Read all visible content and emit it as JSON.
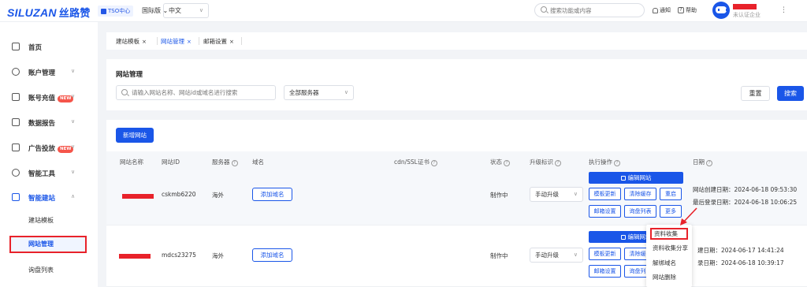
{
  "header": {
    "logo_en": "SILUZAN",
    "logo_cn": "丝路赞",
    "tso_label": "TSO中心",
    "region_label": "国际版",
    "language": "中文",
    "search_placeholder": "搜索功能或内容",
    "notify_label": "通知",
    "help_label": "帮助",
    "user_status": "未认证企业"
  },
  "sidebar": {
    "items": [
      {
        "label": "首页",
        "icon": "home-icon"
      },
      {
        "label": "账户管理",
        "icon": "user-icon"
      },
      {
        "label": "账号充值",
        "icon": "wallet-icon",
        "badge": "NEW"
      },
      {
        "label": "数据报告",
        "icon": "chart-icon"
      },
      {
        "label": "广告投放",
        "icon": "ad-icon",
        "badge": "NEW"
      },
      {
        "label": "智能工具",
        "icon": "layers-icon"
      },
      {
        "label": "智能建站",
        "icon": "site-icon"
      }
    ],
    "subitems": [
      {
        "label": "建站模板"
      },
      {
        "label": "网站管理"
      },
      {
        "label": "询盘列表"
      }
    ]
  },
  "tabs": [
    {
      "label": "建站模板"
    },
    {
      "label": "网站管理"
    },
    {
      "label": "邮箱设置"
    }
  ],
  "search_panel": {
    "title": "网站管理",
    "keyword_placeholder": "请输入网站名称、网站id或域名进行搜索",
    "server_value": "全部服务器",
    "reset_label": "重置",
    "search_label": "搜索"
  },
  "list": {
    "new_site_label": "新增网站",
    "columns": [
      "网站名称",
      "网站ID",
      "服务器",
      "域名",
      "cdn/SSL证书",
      "状态",
      "升级标识",
      "执行操作",
      "日期"
    ],
    "rows": [
      {
        "site_id": "cskmb6220",
        "server": "海外",
        "add_domain": "添加域名",
        "status": "制作中",
        "upgrade": "手动升级",
        "edit_label": "编辑网站",
        "ops": [
          "模板更新",
          "清除缓存",
          "重启",
          "邮箱设置",
          "询盘列表",
          "更多"
        ],
        "created": "网站创建日期：2024-06-18 09:53:30",
        "last_login": "最后登录日期：2024-06-18 10:06:25"
      },
      {
        "site_id": "mdcs23275",
        "server": "海外",
        "add_domain": "添加域名",
        "status": "制作中",
        "upgrade": "手动升级",
        "edit_label": "编辑网站",
        "ops": [
          "模板更新",
          "清除缓存",
          "邮箱设置",
          "询盘列表"
        ],
        "created": "建日期：2024-06-17 14:41:24",
        "last_login": "录日期：2024-06-18 10:39:17"
      }
    ]
  },
  "dropdown": {
    "items": [
      "资料收集",
      "资料收集分享",
      "解绑域名",
      "网站删除"
    ]
  },
  "colors": {
    "primary": "#1a56e8",
    "highlight": "#e8222a",
    "badge": "#f5554a"
  }
}
